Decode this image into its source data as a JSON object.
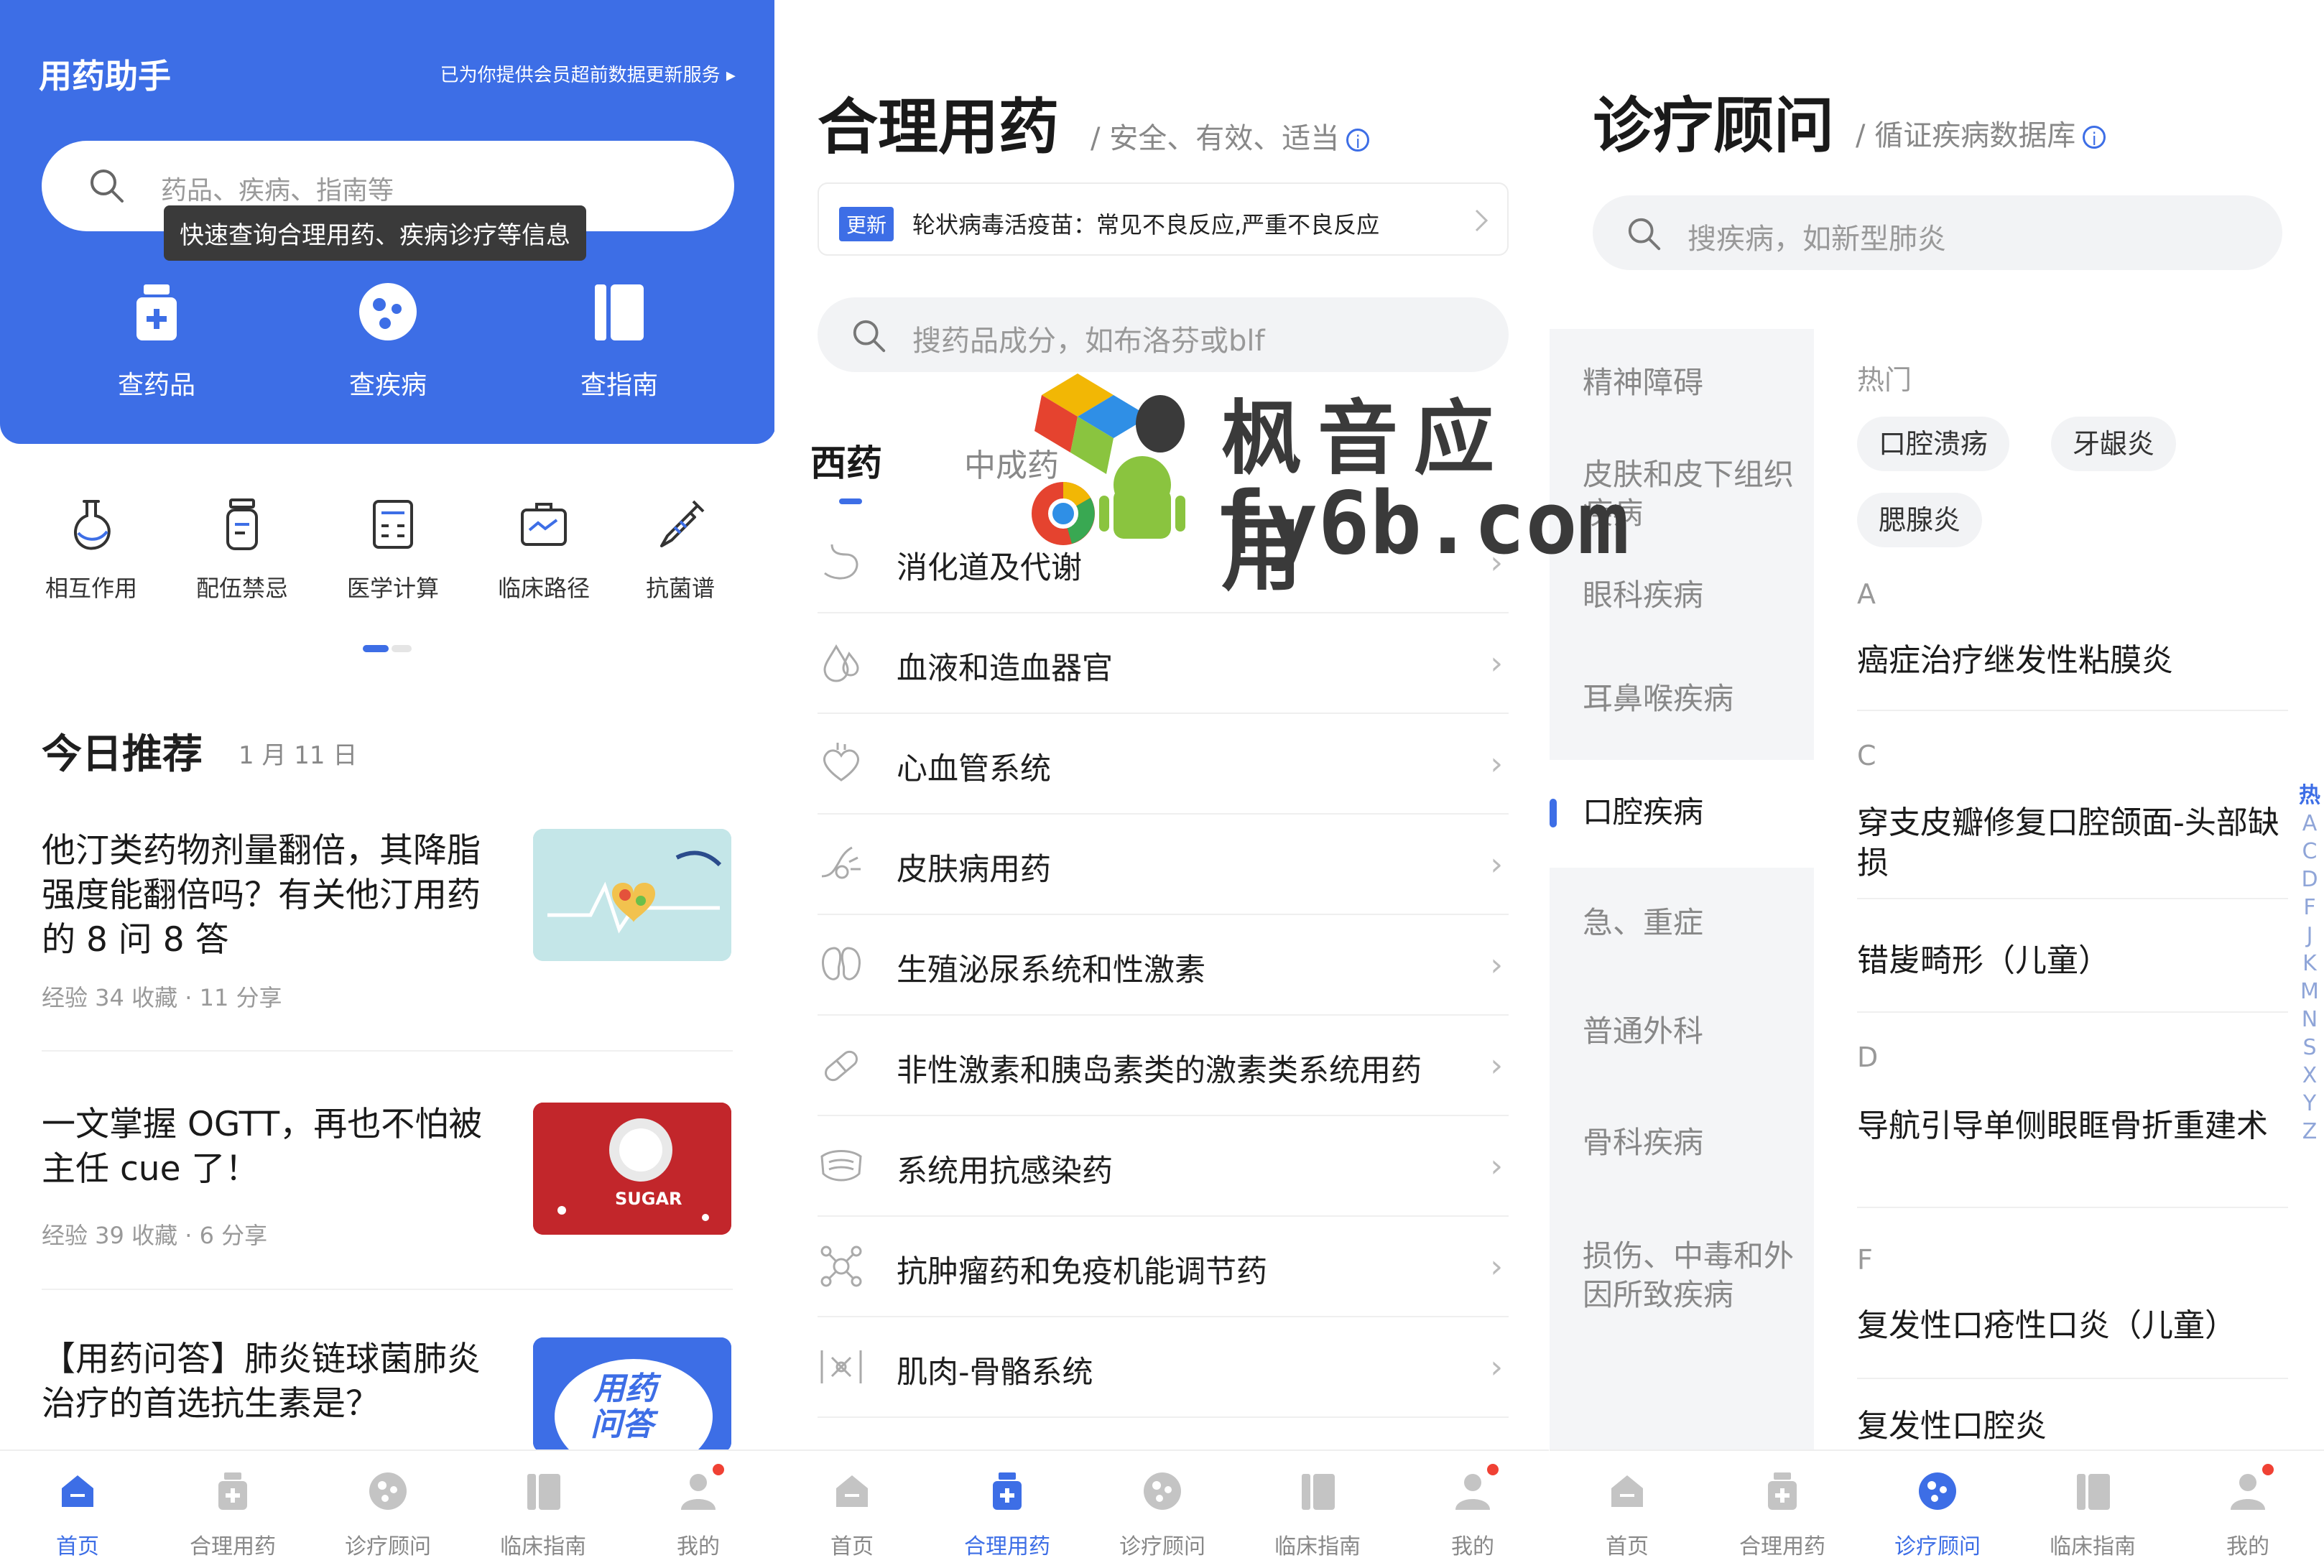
{
  "panel1": {
    "title": "用药助手",
    "notice": "已为你提供会员超前数据更新服务 ▸",
    "search_placeholder": "药品、疾病、指南等",
    "tooltip": "快速查询合理用药、疾病诊疗等信息",
    "quick": [
      {
        "label": "查药品",
        "icon": "medicine-box-icon"
      },
      {
        "label": "查疾病",
        "icon": "virus-icon"
      },
      {
        "label": "查指南",
        "icon": "book-icon"
      }
    ],
    "tools": [
      {
        "label": "相互作用",
        "icon": "flask-icon"
      },
      {
        "label": "配伍禁忌",
        "icon": "bottle-icon"
      },
      {
        "label": "医学计算",
        "icon": "calculator-icon"
      },
      {
        "label": "临床路径",
        "icon": "briefcase-icon"
      },
      {
        "label": "抗菌谱",
        "icon": "syringe-icon"
      }
    ],
    "section_title": "今日推荐",
    "section_date": "1 月 11 日",
    "articles": [
      {
        "title": "他汀类药物剂量翻倍，其降脂强度能翻倍吗？有关他汀用药的 8 问 8 答",
        "meta": "经验   34 收藏  ·  11 分享"
      },
      {
        "title": "一文掌握 OGTT，再也不怕被主任 cue 了！",
        "meta": "经验   39 收藏  ·  6 分享",
        "img_text": "SUGAR"
      },
      {
        "title": "【用药问答】肺炎链球菌肺炎治疗的首选抗生素是？",
        "img_text": "用药问答"
      }
    ]
  },
  "panel2": {
    "title": "合理用药",
    "subtitle": "/ 安全、有效、适当",
    "update_badge": "更新",
    "update_text": "轮状病毒活疫苗：常见不良反应,严重不良反应",
    "search_placeholder": "搜药品成分，如布洛芬或blf",
    "tabs": [
      "西药",
      "中成药"
    ],
    "categories": [
      {
        "label": "消化道及代谢",
        "icon": "stomach-icon"
      },
      {
        "label": "血液和造血器官",
        "icon": "blood-drop-icon"
      },
      {
        "label": "心血管系统",
        "icon": "heart-icon"
      },
      {
        "label": "皮肤病用药",
        "icon": "skin-icon"
      },
      {
        "label": "生殖泌尿系统和性激素",
        "icon": "kidney-icon"
      },
      {
        "label": "非性激素和胰岛素类的激素类系统用药",
        "icon": "pill-icon"
      },
      {
        "label": "系统用抗感染药",
        "icon": "mask-icon"
      },
      {
        "label": "抗肿瘤药和免疫机能调节药",
        "icon": "molecule-icon"
      },
      {
        "label": "肌肉-骨骼系统",
        "icon": "bone-icon"
      }
    ]
  },
  "panel3": {
    "title": "诊疗顾问",
    "subtitle": "/ 循证疾病数据库",
    "search_placeholder": "搜疾病，如新型肺炎",
    "sidebar": [
      "精神障碍",
      "皮肤和皮下组织疾病",
      "眼科疾病",
      "耳鼻喉疾病",
      "口腔疾病",
      "急、重症",
      "普通外科",
      "骨科疾病",
      "损伤、中毒和外因所致疾病"
    ],
    "hot_label": "热门",
    "hot_chips": [
      "口腔溃疡",
      "牙龈炎",
      "腮腺炎"
    ],
    "groups": [
      {
        "letter": "A",
        "items": [
          "癌症治疗继发性粘膜炎"
        ]
      },
      {
        "letter": "C",
        "items": [
          "穿支皮瓣修复口腔颌面-头部缺损",
          "错㿫畸形（儿童）"
        ]
      },
      {
        "letter": "D",
        "items": [
          "导航引导单侧眼眶骨折重建术"
        ]
      },
      {
        "letter": "F",
        "items": [
          "复发性口疮性口炎（儿童）",
          "复发性口腔炎"
        ]
      }
    ],
    "index": [
      "热",
      "A",
      "C",
      "D",
      "F",
      "J",
      "K",
      "M",
      "N",
      "S",
      "X",
      "Y",
      "Z"
    ]
  },
  "tabbar": [
    "首页",
    "合理用药",
    "诊疗顾问",
    "临床指南",
    "我的"
  ],
  "watermark": {
    "cn": "枫音应用",
    "en": "fy6b.com"
  },
  "colors": {
    "accent": "#3d6ee6",
    "badge": "#f04134"
  }
}
